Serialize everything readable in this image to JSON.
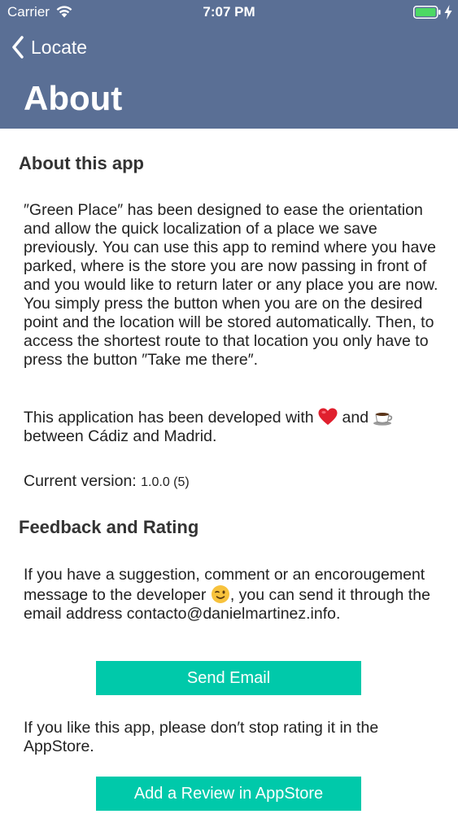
{
  "status_bar": {
    "carrier": "Carrier",
    "time": "7:07 PM",
    "wifi_icon": "wifi-icon",
    "battery_icon": "battery-full-icon",
    "charging_icon": "bolt-icon"
  },
  "nav": {
    "back_label": "Locate",
    "back_icon": "chevron-left-icon",
    "title": "About",
    "background_color": "#5a6f95"
  },
  "about": {
    "heading": "About this app",
    "description": "″Green Place″ has been designed to ease the orientation and allow the quick localization of a place we save previously. You can use this app to remind where you have parked, where is the store you are now passing in front of and you would like to return later or any place you are now. You simply press the button when you are on the desired point and the location will be stored automatically. Then, to access the shortest route to that location you only have to press the button ″Take me there″.",
    "developed_prefix": "This application has been developed with",
    "developed_and": "and",
    "developed_suffix": "between Cádiz and Madrid.",
    "heart_icon": "heart-icon",
    "coffee_icon": "coffee-icon",
    "version_label": "Current version:",
    "version_value": "1.0.0 (5)"
  },
  "feedback": {
    "heading": "Feedback and Rating",
    "message_part1": "If you have a suggestion, comment or an encorougement message to the developer",
    "message_part2": ", you can send it through the email address contacto@danielmartinez.info.",
    "wink_icon": "winking-face-icon",
    "send_email_label": "Send Email",
    "rating_text": "If you like this app, please don′t stop rating it in the AppStore.",
    "review_label": "Add a Review in AppStore",
    "button_color": "#00c9aa"
  }
}
